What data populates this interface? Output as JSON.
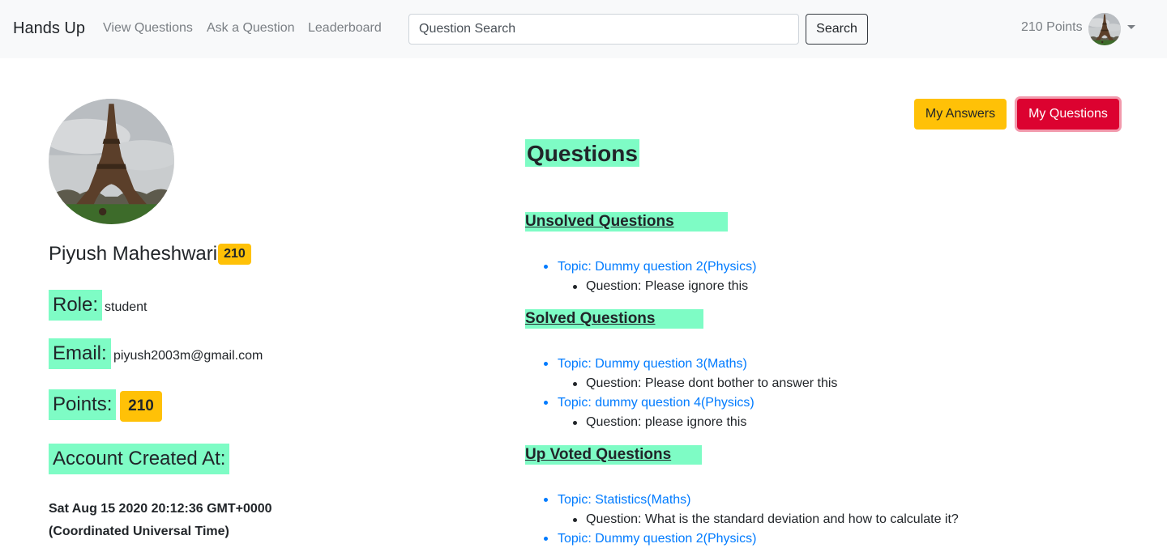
{
  "navbar": {
    "brand": "Hands Up",
    "links": [
      "View Questions",
      "Ask a Question",
      "Leaderboard"
    ],
    "search_placeholder": "Question Search",
    "search_button": "Search",
    "points": "210 Points"
  },
  "profile": {
    "name": "Piyush Maheshwari",
    "name_badge": "210",
    "role_label": "Role:",
    "role_value": "student",
    "email_label": "Email:",
    "email_value": "piyush2003m@gmail.com",
    "points_label": "Points:",
    "points_value": "210",
    "created_label": "Account Created At:",
    "created_date": "Sat Aug 15 2020 20:12:36 GMT+0000",
    "created_tz": "(Coordinated Universal Time)"
  },
  "buttons": {
    "my_answers": "My Answers",
    "my_questions": "My Questions"
  },
  "questions": {
    "title": "Questions",
    "unsolved_title": "Unsolved Questions",
    "unsolved": [
      {
        "topic": "Topic: Dummy question 2(Physics)",
        "question": "Question: Please ignore this"
      }
    ],
    "solved_title": "Solved Questions",
    "solved": [
      {
        "topic": "Topic: Dummy question 3(Maths)",
        "question": "Question: Please dont bother to answer this"
      },
      {
        "topic": "Topic: dummy question 4(Physics)",
        "question": "Question: please ignore this"
      }
    ],
    "upvoted_title": "Up Voted Questions",
    "upvoted": [
      {
        "topic": "Topic: Statistics(Maths)",
        "question": "Question: What is the standard deviation and how to calculate it?"
      },
      {
        "topic": "Topic: Dummy question 2(Physics)",
        "question": ""
      }
    ]
  },
  "colors": {
    "highlight": "#7efcc5",
    "badge": "#ffc107",
    "link": "#007bff",
    "danger": "#dc0230"
  }
}
